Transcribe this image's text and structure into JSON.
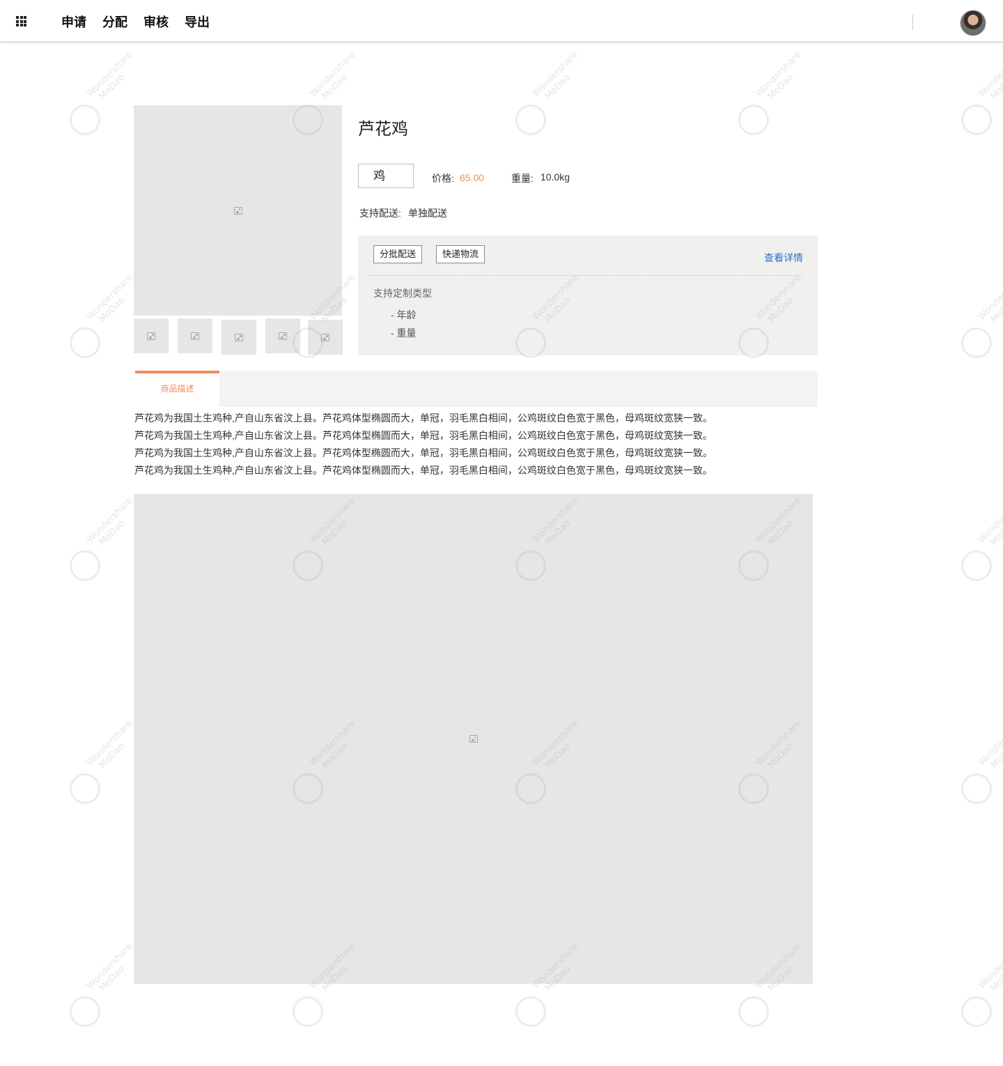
{
  "header": {
    "nav": [
      "申请",
      "分配",
      "审核",
      "导出"
    ]
  },
  "icons": {
    "apps": "grid-menu-icon",
    "image": "image-placeholder-icon"
  },
  "product": {
    "title": "芦花鸡",
    "variant": "鸡",
    "price_label": "价格:",
    "price_value": "65.00",
    "weight_label": "重量:",
    "weight_value": "10.0kg",
    "delivery_label": "支持配送:",
    "delivery_value": "单独配送",
    "delivery_tags": [
      "分批配送",
      "快递物流"
    ],
    "view_detail": "查看详情",
    "custom_label": "支持定制类型",
    "custom_items": [
      "- 年龄",
      "- 重量"
    ]
  },
  "tabs": {
    "active": "商品描述"
  },
  "description": [
    "芦花鸡为我国土生鸡种,产自山东省汶上县。芦花鸡体型椭圆而大，单冠，羽毛黑白相间，公鸡斑纹白色宽于黑色，母鸡斑纹宽狭一致。",
    "芦花鸡为我国土生鸡种,产自山东省汶上县。芦花鸡体型椭圆而大，单冠，羽毛黑白相间，公鸡斑纹白色宽于黑色，母鸡斑纹宽狭一致。",
    "芦花鸡为我国土生鸡种,产自山东省汶上县。芦花鸡体型椭圆而大，单冠，羽毛黑白相间，公鸡斑纹白色宽于黑色，母鸡斑纹宽狭一致。",
    "芦花鸡为我国土生鸡种,产自山东省汶上县。芦花鸡体型椭圆而大，单冠，羽毛黑白相间，公鸡斑纹白色宽于黑色，母鸡斑纹宽狭一致。"
  ],
  "watermark": {
    "line1": "Wondershare",
    "line2": "MoDao"
  },
  "colors": {
    "accent": "#f08c5a",
    "link": "#2d6fd0",
    "panel": "#f0f1ef",
    "placeholder": "#e6e6e6"
  }
}
